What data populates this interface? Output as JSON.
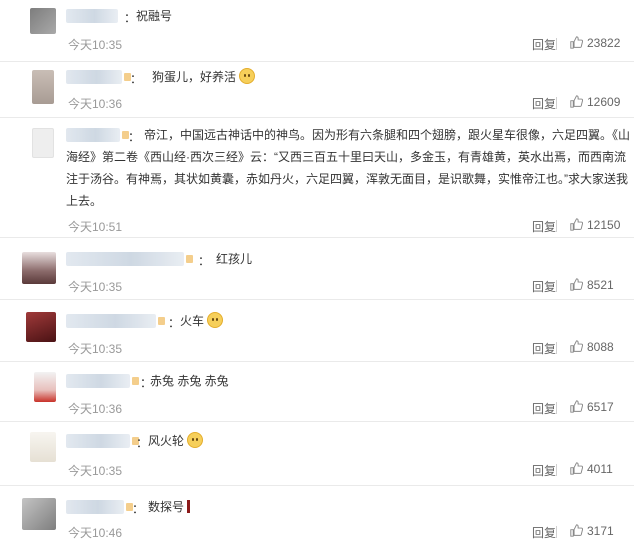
{
  "comments": [
    {
      "text": "祝融号",
      "time": "今天10:35",
      "reply_label": "回复",
      "likes": "23822",
      "avatar_color": "#8a8a8a",
      "emoji": false
    },
    {
      "text": "狗蛋儿，好养活",
      "time": "今天10:36",
      "reply_label": "回复",
      "likes": "12609",
      "avatar_color": "#b8aca4",
      "emoji": true
    },
    {
      "text": "帝江，中国远古神话中的神鸟。因为形有六条腿和四个翅膀，跟火星车很像，六足四翼。《山海经》第二卷《西山经·西次三经》云：“又西三百五十里曰天山，多金玉，有青雄黄，英水出焉，而西南流注于汤谷。有神焉，其状如黄囊，赤如丹火，六足四翼，浑敦无面目，是识歌舞，实惟帝江也。”求大家送我上去。",
      "time": "今天10:51",
      "reply_label": "回复",
      "likes": "12150",
      "avatar_color": "#ececec",
      "emoji": false
    },
    {
      "text": "红孩儿",
      "time": "今天10:35",
      "reply_label": "回复",
      "likes": "8521",
      "avatar_color": "#7a5a5a",
      "emoji": false
    },
    {
      "text": "火车",
      "time": "今天10:35",
      "reply_label": "回复",
      "likes": "8088",
      "avatar_color": "#6b1e20",
      "emoji": true
    },
    {
      "text": "赤兔 赤兔 赤兔",
      "time": "今天10:36",
      "reply_label": "回复",
      "likes": "6517",
      "avatar_color": "#c8504a",
      "emoji": false
    },
    {
      "text": "风火轮",
      "time": "今天10:35",
      "reply_label": "回复",
      "likes": "4011",
      "avatar_color": "#f1ede6",
      "emoji": true
    },
    {
      "text": "数探号",
      "time": "今天10:46",
      "reply_label": "回复",
      "likes": "3171",
      "avatar_color": "#9a9a9a",
      "emoji": false
    }
  ],
  "separator": "："
}
